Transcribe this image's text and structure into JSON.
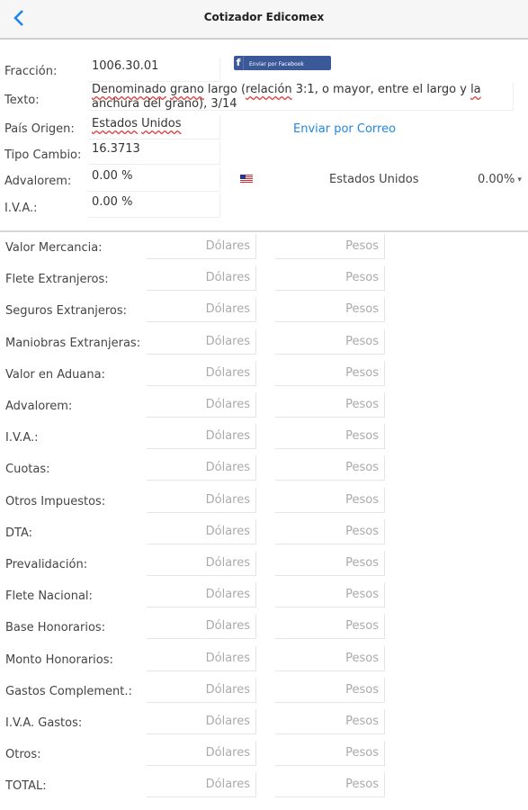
{
  "header": {
    "title": "Cotizador Edicomex"
  },
  "info": {
    "fraccion_label": "Fracción:",
    "fraccion_value": "1006.30.01",
    "texto_label": "Texto:",
    "texto_line1_w1": "Denominado",
    "texto_line1_w2": "grano",
    "texto_line1_w3": " largo (",
    "texto_line1_w4": "relación",
    "texto_line1_w5": " 3:1, o mayor, entre el largo y ",
    "texto_line1_w6": "la",
    "texto_line2": "anchura del grano), 3/14",
    "pais_label": "País Origen:",
    "pais_value_w1": "Estados",
    "pais_value_w2": "Unidos",
    "tipo_label": "Tipo Cambio:",
    "tipo_value": "16.3713",
    "adval_label": "Advalorem:",
    "adval_value": "0.00 %",
    "iva_label": "I.V.A.:",
    "iva_value": "0.00 %",
    "fb_button": "Enviar por Facebook",
    "mail_link": "Enviar por Correo",
    "country_select": "Estados Unidos",
    "pct_select": "0.00%"
  },
  "grid": {
    "dolares_placeholder": "Dólares",
    "pesos_placeholder": "Pesos",
    "rows": [
      {
        "label": "Valor Mercancia:"
      },
      {
        "label": "Flete Extranjeros:"
      },
      {
        "label": "Seguros Extranjeros:"
      },
      {
        "label": "Maniobras Extranjeras:"
      },
      {
        "label": "Valor en Aduana:"
      },
      {
        "label": "Advalorem:"
      },
      {
        "label": "I.V.A.:"
      },
      {
        "label": "Cuotas:"
      },
      {
        "label": "Otros Impuestos:"
      },
      {
        "label": "DTA:"
      },
      {
        "label": "Prevalidación:"
      },
      {
        "label": "Flete Nacional:"
      },
      {
        "label": "Base Honorarios:"
      },
      {
        "label": "Monto Honorarios:"
      },
      {
        "label": "Gastos Complement.:"
      },
      {
        "label": "I.V.A. Gastos:"
      },
      {
        "label": "Otros:"
      },
      {
        "label": "TOTAL:"
      }
    ]
  },
  "colors": {
    "accent": "#1e88e5",
    "facebook": "#3b5998"
  }
}
